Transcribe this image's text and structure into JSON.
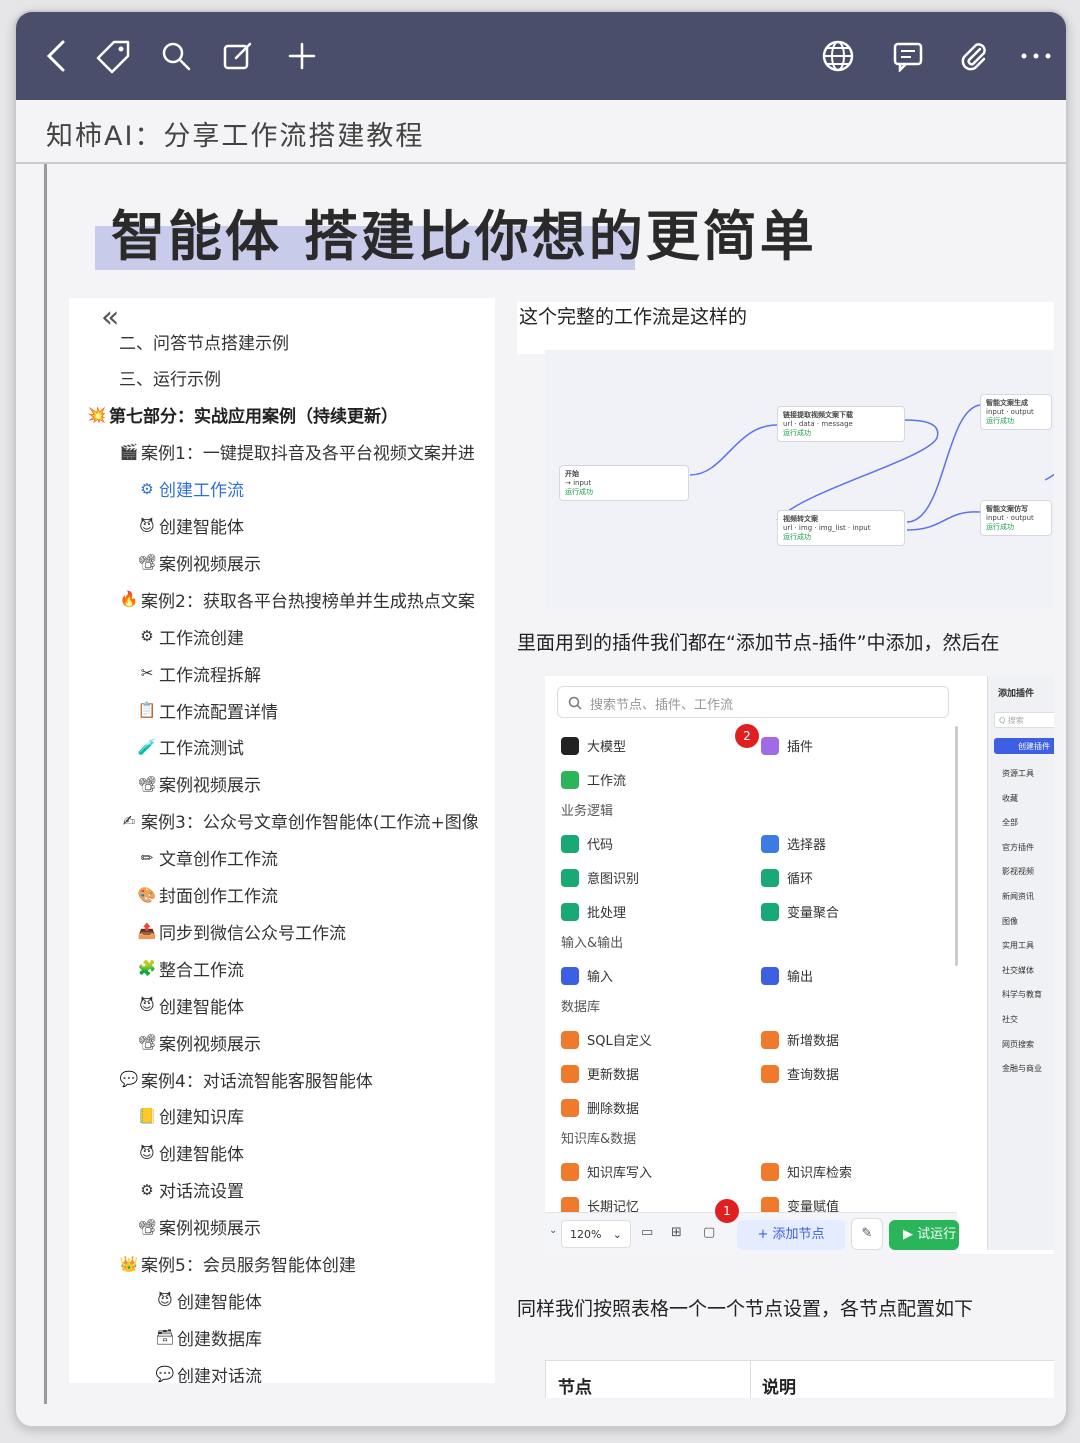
{
  "title": "知柿AI：分享工作流搭建教程",
  "headline": "智能体 搭建比你想的更简单",
  "toc": {
    "collapse": "«",
    "items": [
      {
        "icon": "",
        "text": "二、问答节点搭建示例"
      },
      {
        "icon": "",
        "text": "三、运行示例"
      },
      {
        "icon": "💥",
        "text": "第七部分：实战应用案例（持续更新）"
      },
      {
        "icon": "🎬",
        "text": "案例1：一键提取抖音及各平台视频文案并进"
      },
      {
        "icon": "⚙",
        "text": "创建工作流"
      },
      {
        "icon": "😈",
        "text": "创建智能体"
      },
      {
        "icon": "📽",
        "text": "案例视频展示"
      },
      {
        "icon": "🔥",
        "text": "案例2：获取各平台热搜榜单并生成热点文案"
      },
      {
        "icon": "⚙",
        "text": "工作流创建"
      },
      {
        "icon": "✂",
        "text": "工作流程拆解"
      },
      {
        "icon": "📋",
        "text": "工作流配置详情"
      },
      {
        "icon": "🧪",
        "text": "工作流测试"
      },
      {
        "icon": "📽",
        "text": "案例视频展示"
      },
      {
        "icon": "✍",
        "text": "案例3：公众号文章创作智能体(工作流+图像"
      },
      {
        "icon": "✏",
        "text": "文章创作工作流"
      },
      {
        "icon": "🎨",
        "text": "封面创作工作流"
      },
      {
        "icon": "📤",
        "text": "同步到微信公众号工作流"
      },
      {
        "icon": "🧩",
        "text": "整合工作流"
      },
      {
        "icon": "😈",
        "text": "创建智能体"
      },
      {
        "icon": "📽",
        "text": "案例视频展示"
      },
      {
        "icon": "💬",
        "text": "案例4：对话流智能客服智能体"
      },
      {
        "icon": "📒",
        "text": "创建知识库"
      },
      {
        "icon": "😈",
        "text": "创建智能体"
      },
      {
        "icon": "⚙",
        "text": "对话流设置"
      },
      {
        "icon": "📽",
        "text": "案例视频展示"
      },
      {
        "icon": "👑",
        "text": "案例5：会员服务智能体创建"
      },
      {
        "icon": "😈",
        "text": "创建智能体"
      },
      {
        "icon": "🗃",
        "text": "创建数据库"
      },
      {
        "icon": "💬",
        "text": "创建对话流"
      }
    ]
  },
  "article": {
    "p1": "这个完整的工作流是这样的",
    "p2": "里面用到的插件我们都在“添加节点-插件”中添加，然后在",
    "p3": "同样我们按照表格一个一个节点设置，各节点配置如下"
  },
  "workflow_nodes": [
    {
      "title": "开始",
      "rows": "→ input",
      "status": "运行成功"
    },
    {
      "title": "链接提取视频文案下载",
      "rows": "url · data · message",
      "status": "运行成功"
    },
    {
      "title": "视频转文案",
      "rows": "url · img · img_list · input",
      "status": "运行成功"
    },
    {
      "title": "智能文案生成",
      "rows": "input · output",
      "status": "运行成功"
    },
    {
      "title": "智能文案仿写",
      "rows": "input · output",
      "status": "运行成功"
    }
  ],
  "plugin_panel": {
    "search_placeholder": "搜索节点、插件、工作流",
    "groups": [
      "业务逻辑",
      "输入&输出",
      "数据库",
      "知识库&数据"
    ],
    "items": [
      "大模型",
      "插件",
      "工作流",
      "代码",
      "选择器",
      "意图识别",
      "循环",
      "批处理",
      "变量聚合",
      "输入",
      "输出",
      "SQL自定义",
      "新增数据",
      "更新数据",
      "查询数据",
      "删除数据",
      "知识库写入",
      "知识库检索",
      "长期记忆",
      "变量赋值"
    ],
    "badge1": "1",
    "badge2": "2",
    "zoom": "120%",
    "add_node": "+ 添加节点",
    "try_run": "▶ 试运行",
    "side_title": "添加插件",
    "side_search": "Q 搜索",
    "side_create": "创建插件",
    "side_items": [
      "资源工具",
      "收藏",
      "全部",
      "官方插件",
      "影视视频",
      "新闻资讯",
      "图像",
      "实用工具",
      "社交媒体",
      "科学与教育",
      "社交",
      "网页搜索",
      "金融与商业"
    ]
  },
  "table": {
    "col1": "节点",
    "col2": "说明"
  }
}
